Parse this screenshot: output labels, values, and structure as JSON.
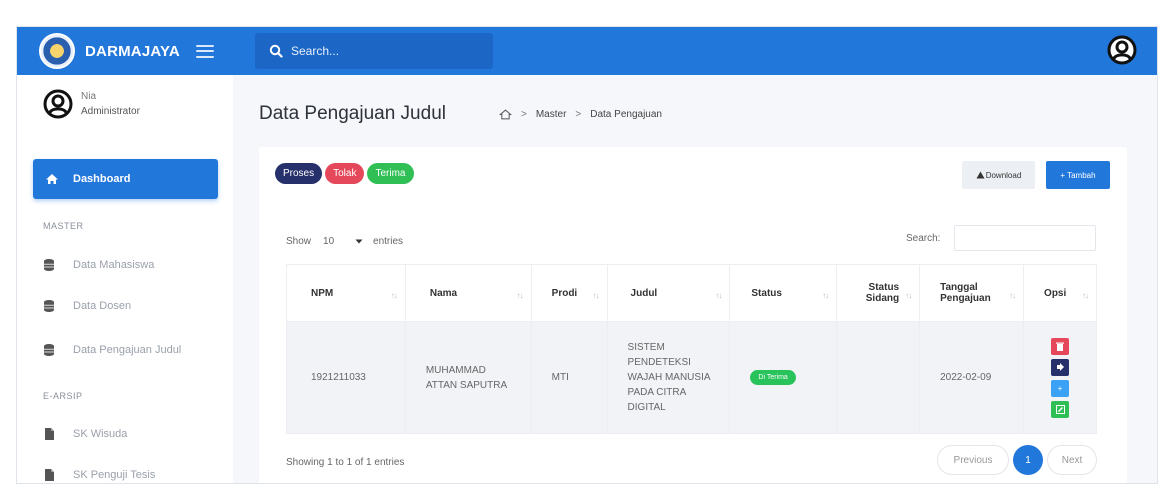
{
  "header": {
    "brand": "DARMAJAYA",
    "search_placeholder": "Search..."
  },
  "sidebar": {
    "user_name": "Nia",
    "user_role": "Administrator",
    "active_item": "Dashboard",
    "section_master": "MASTER",
    "section_earsip": "E-ARSIP",
    "items": [
      {
        "label": "Data Mahasiswa",
        "icon": "database-icon"
      },
      {
        "label": "Data Dosen",
        "icon": "database-icon"
      },
      {
        "label": "Data Pengajuan Judul",
        "icon": "database-icon"
      },
      {
        "label": "SK Wisuda",
        "icon": "file-icon"
      },
      {
        "label": "SK Penguji Tesis",
        "icon": "file-icon"
      }
    ]
  },
  "main": {
    "title": "Data Pengajuan Judul",
    "breadcrumb": [
      "Master",
      "Data Pengajuan"
    ],
    "filters": [
      {
        "label": "Proses",
        "color": "#26306b"
      },
      {
        "label": "Tolak",
        "color": "#e5485a"
      },
      {
        "label": "Terima",
        "color": "#2fbf55"
      }
    ],
    "download_label": "Download",
    "tambah_label": "Tambah",
    "show_label": "Show",
    "entries_value": "10",
    "entries_label": "entries",
    "search_label": "Search:",
    "columns": [
      "NPM",
      "Nama",
      "Prodi",
      "Judul",
      "Status",
      "Status Sidang",
      "Tanggal Pengajuan",
      "Opsi"
    ],
    "rows": [
      {
        "npm": "1921211033",
        "nama": "MUHAMMAD ATTAN SAPUTRA",
        "prodi": "MTI",
        "judul": "SISTEM PENDETEKSI WAJAH MANUSIA PADA CITRA DIGITAL",
        "status": "Di Terima",
        "status_sidang": "",
        "tanggal": "2022-02-09"
      }
    ],
    "showing": "Showing 1 to 1 of 1 entries",
    "pagination": {
      "previous": "Previous",
      "current": "1",
      "next": "Next"
    }
  },
  "colors": {
    "primary": "#2277db",
    "delete": "#e5485a",
    "view": "#26306b",
    "info": "#3aa1f5",
    "edit": "#2fbf55"
  }
}
